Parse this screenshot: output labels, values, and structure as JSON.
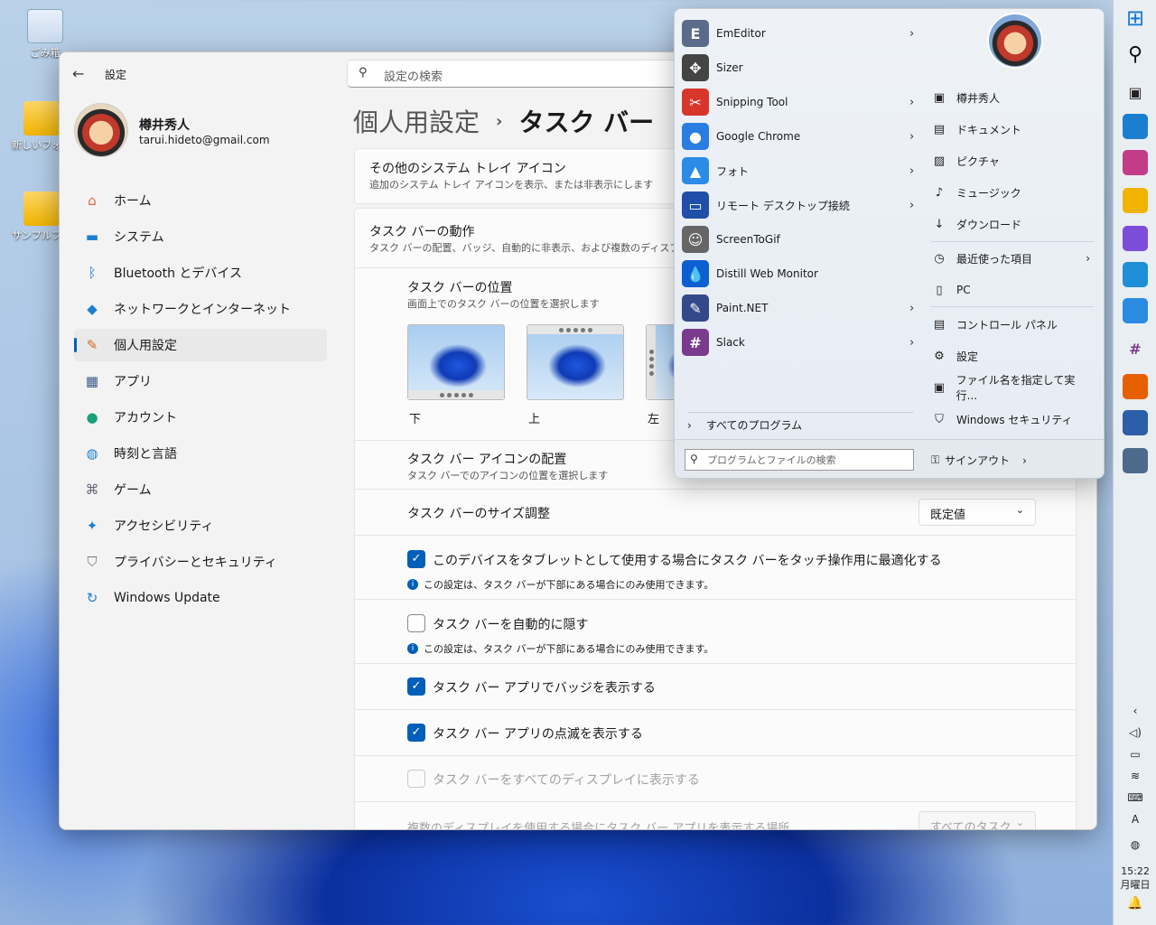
{
  "desktop": {
    "icons": [
      {
        "label": "ごみ箱"
      },
      {
        "label": "新しいフォル"
      },
      {
        "label": "サンプルフォ"
      }
    ]
  },
  "settings": {
    "title": "設定",
    "search_placeholder": "設定の検索",
    "user": {
      "name": "樽井秀人",
      "email": "tarui.hideto@gmail.com"
    },
    "nav": [
      {
        "label": "ホーム",
        "icon": "home-icon"
      },
      {
        "label": "システム",
        "icon": "system-icon"
      },
      {
        "label": "Bluetooth とデバイス",
        "icon": "bluetooth-icon"
      },
      {
        "label": "ネットワークとインターネット",
        "icon": "wifi-icon"
      },
      {
        "label": "個人用設定",
        "icon": "brush-icon",
        "selected": true
      },
      {
        "label": "アプリ",
        "icon": "apps-icon"
      },
      {
        "label": "アカウント",
        "icon": "account-icon"
      },
      {
        "label": "時刻と言語",
        "icon": "globe-icon"
      },
      {
        "label": "ゲーム",
        "icon": "gamepad-icon"
      },
      {
        "label": "アクセシビリティ",
        "icon": "accessibility-icon"
      },
      {
        "label": "プライバシーとセキュリティ",
        "icon": "shield-icon"
      },
      {
        "label": "Windows Update",
        "icon": "update-icon"
      }
    ],
    "breadcrumb": {
      "parent": "個人用設定",
      "sep": "›",
      "current": "タスク バー"
    },
    "other_tray": {
      "title": "その他のシステム トレイ アイコン",
      "sub": "追加のシステム トレイ アイコンを表示、または非表示にします"
    },
    "behavior": {
      "title": "タスク バーの動作",
      "sub": "タスク バーの配置、バッジ、自動的に非表示、および複数のディスプレイ"
    },
    "position": {
      "title": "タスク バーの位置",
      "sub": "画面上でのタスク バーの位置を選択します",
      "options": [
        "下",
        "上",
        "左"
      ]
    },
    "alignment": {
      "title": "タスク バー アイコンの配置",
      "sub": "タスク バーでのアイコンの位置を選択します"
    },
    "size": {
      "label": "タスク バーのサイズ調整",
      "value": "既定値"
    },
    "checks": [
      {
        "label": "このデバイスをタブレットとして使用する場合にタスク バーをタッチ操作用に最適化する",
        "checked": true,
        "note": "この設定は、タスク バーが下部にある場合にのみ使用できます。"
      },
      {
        "label": "タスク バーを自動的に隠す",
        "checked": false,
        "note": "この設定は、タスク バーが下部にある場合にのみ使用できます。"
      },
      {
        "label": "タスク バー アプリでバッジを表示する",
        "checked": true
      },
      {
        "label": "タスク バー アプリの点滅を表示する",
        "checked": true
      },
      {
        "label": "タスク バーをすべてのディスプレイに表示する",
        "checked": false,
        "disabled": true
      }
    ],
    "multi": {
      "label": "複数のディスプレイを使用する場合にタスク バー アプリを表示する場所",
      "value": "すべてのタスク バー"
    },
    "check_mark": "✓",
    "info_mark": "i",
    "dd_chev": "⌄",
    "back_glyph": "←"
  },
  "start_menu": {
    "programs": [
      {
        "label": "EmEditor",
        "icon": "emeditor-icon",
        "color": "#5b6b8a",
        "glyph": "E",
        "arrow": true
      },
      {
        "label": "Sizer",
        "icon": "sizer-icon",
        "color": "#444",
        "glyph": "✥",
        "arrow": false
      },
      {
        "label": "Snipping Tool",
        "icon": "snipping-icon",
        "color": "#d9362b",
        "glyph": "✂",
        "arrow": true
      },
      {
        "label": "Google Chrome",
        "icon": "chrome-icon",
        "color": "#2a7de1",
        "glyph": "●",
        "arrow": true
      },
      {
        "label": "フォト",
        "icon": "photos-icon",
        "color": "#2c8be6",
        "glyph": "▲",
        "arrow": true
      },
      {
        "label": "リモート デスクトップ接続",
        "icon": "remote-desktop-icon",
        "color": "#1f4fa8",
        "glyph": "▭",
        "arrow": true
      },
      {
        "label": "ScreenToGif",
        "icon": "screentogif-icon",
        "color": "#666",
        "glyph": "☺",
        "arrow": false
      },
      {
        "label": "Distill Web Monitor",
        "icon": "distill-icon",
        "color": "#0b5fd0",
        "glyph": "💧",
        "arrow": false
      },
      {
        "label": "Paint.NET",
        "icon": "paintnet-icon",
        "color": "#334a8a",
        "glyph": "✎",
        "arrow": true
      },
      {
        "label": "Slack",
        "icon": "slack-icon",
        "color": "#7a3b8f",
        "glyph": "#",
        "arrow": true
      }
    ],
    "all_programs": "すべてのプログラム",
    "search_placeholder": "プログラムとファイルの検索",
    "signout": "サインアウト",
    "right": [
      {
        "label": "樽井秀人",
        "icon": "user-folder-icon",
        "glyph": "▣"
      },
      {
        "label": "ドキュメント",
        "icon": "document-icon",
        "glyph": "▤"
      },
      {
        "label": "ピクチャ",
        "icon": "picture-icon",
        "glyph": "▨"
      },
      {
        "label": "ミュージック",
        "icon": "music-icon",
        "glyph": "♪"
      },
      {
        "label": "ダウンロード",
        "icon": "download-icon",
        "glyph": "↓"
      },
      {
        "label": "最近使った項目",
        "icon": "recent-icon",
        "glyph": "◷",
        "arrow": true
      },
      {
        "label": "PC",
        "icon": "pc-icon",
        "glyph": "▯"
      },
      {
        "label": "コントロール パネル",
        "icon": "control-panel-icon",
        "glyph": "▤"
      },
      {
        "label": "設定",
        "icon": "settings-gear-icon",
        "glyph": "⚙"
      },
      {
        "label": "ファイル名を指定して実行...",
        "icon": "run-icon",
        "glyph": "▣"
      },
      {
        "label": "Windows セキュリティ",
        "icon": "security-icon",
        "glyph": "⛉"
      }
    ]
  },
  "taskbar": {
    "time": "15:22",
    "day": "月曜日",
    "apps": [
      {
        "icon": "start-icon",
        "color": "#1677d2"
      },
      {
        "icon": "search-icon",
        "color": "#e9eef3"
      },
      {
        "icon": "taskview-icon",
        "color": "#e9eef3"
      },
      {
        "icon": "widgets-icon",
        "color": "#1b7fcf"
      },
      {
        "icon": "m365-icon",
        "color": "#c23c87"
      },
      {
        "icon": "explorer-icon",
        "color": "#f0b400"
      },
      {
        "icon": "copilot-icon",
        "color": "#7c4dd9"
      },
      {
        "icon": "edge-icon",
        "color": "#1e8fd6"
      },
      {
        "icon": "photos-taskbar-icon",
        "color": "#2a8be0"
      },
      {
        "icon": "slack-taskbar-icon",
        "color": "#e9eef3"
      },
      {
        "icon": "firefox-icon",
        "color": "#e66000"
      },
      {
        "icon": "reader-icon",
        "color": "#2d5ea8"
      },
      {
        "icon": "settings-taskbar-icon",
        "color": "#4d6a8a"
      }
    ],
    "tray": [
      {
        "icon": "chevron-up-icon",
        "glyph": "‹"
      },
      {
        "icon": "volume-icon",
        "glyph": "◁)"
      },
      {
        "icon": "battery-icon",
        "glyph": "▭"
      },
      {
        "icon": "wifi-tray-icon",
        "glyph": "≋"
      },
      {
        "icon": "keyboard-icon",
        "glyph": "⌨"
      },
      {
        "icon": "ime-icon",
        "glyph": "A"
      },
      {
        "icon": "network-globe-icon",
        "glyph": "◍"
      }
    ],
    "bell": "🔔"
  }
}
